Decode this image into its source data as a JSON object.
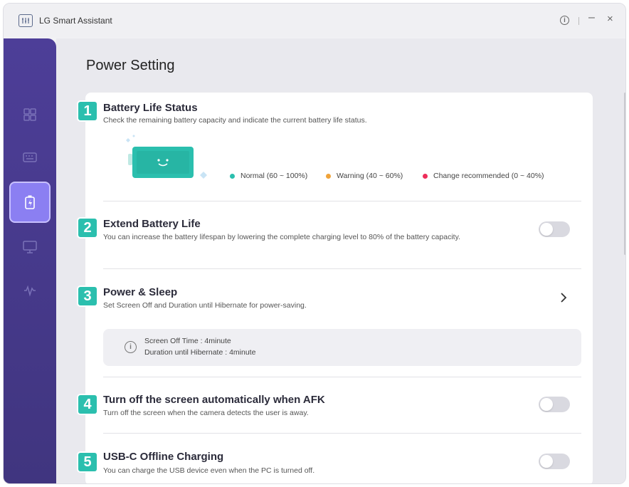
{
  "app": {
    "title": "LG Smart Assistant"
  },
  "titlebar": {
    "info_icon": "info-circle-icon",
    "minimize_icon": "minimize-icon",
    "close_icon": "close-icon",
    "info_glyph": "i",
    "minimize_glyph": "–",
    "close_glyph": "×"
  },
  "sidebar": {
    "items": [
      {
        "icon": "dashboard-grid-icon",
        "active": false
      },
      {
        "icon": "keyboard-icon",
        "active": false
      },
      {
        "icon": "battery-charge-icon",
        "active": true
      },
      {
        "icon": "monitor-icon",
        "active": false
      },
      {
        "icon": "audio-wave-icon",
        "active": false
      }
    ]
  },
  "page": {
    "title": "Power Setting"
  },
  "sections": {
    "battery_status": {
      "number": "1",
      "title": "Battery Life Status",
      "description": "Check the remaining battery capacity and indicate the current battery life status.",
      "legend": [
        {
          "label": "Normal (60 ~ 100%)",
          "color": "#2bbfae"
        },
        {
          "label": "Warning (40 ~ 60%)",
          "color": "#f0a33a"
        },
        {
          "label": "Change recommended (0 ~ 40%)",
          "color": "#ee2d5a"
        }
      ],
      "battery_color": "#2bbfae",
      "battery_face": "·ᴗ·"
    },
    "extend_battery": {
      "number": "2",
      "title": "Extend Battery Life",
      "description": "You can increase the battery lifespan by lowering the complete charging level to 80% of the battery capacity.",
      "enabled": false
    },
    "power_sleep": {
      "number": "3",
      "title": "Power & Sleep",
      "description": "Set Screen Off and Duration until Hibernate for power-saving.",
      "info_glyph": "i",
      "info": {
        "screen_off": "Screen Off Time  : 4minute",
        "hibernate": "Duration until Hibernate  : 4minute"
      }
    },
    "afk_screen_off": {
      "number": "4",
      "title": "Turn off the screen automatically when AFK",
      "description": "Turn off the screen when the camera detects the user is away.",
      "enabled": false
    },
    "usbc_charging": {
      "number": "5",
      "title": "USB-C Offline Charging",
      "description": "You can charge the USB device even when the PC is turned off.",
      "enabled": false
    }
  },
  "colors": {
    "accent": "#2bbfae",
    "sidebar": "#4d3e98",
    "sidebar_active": "#8b7ff2"
  }
}
